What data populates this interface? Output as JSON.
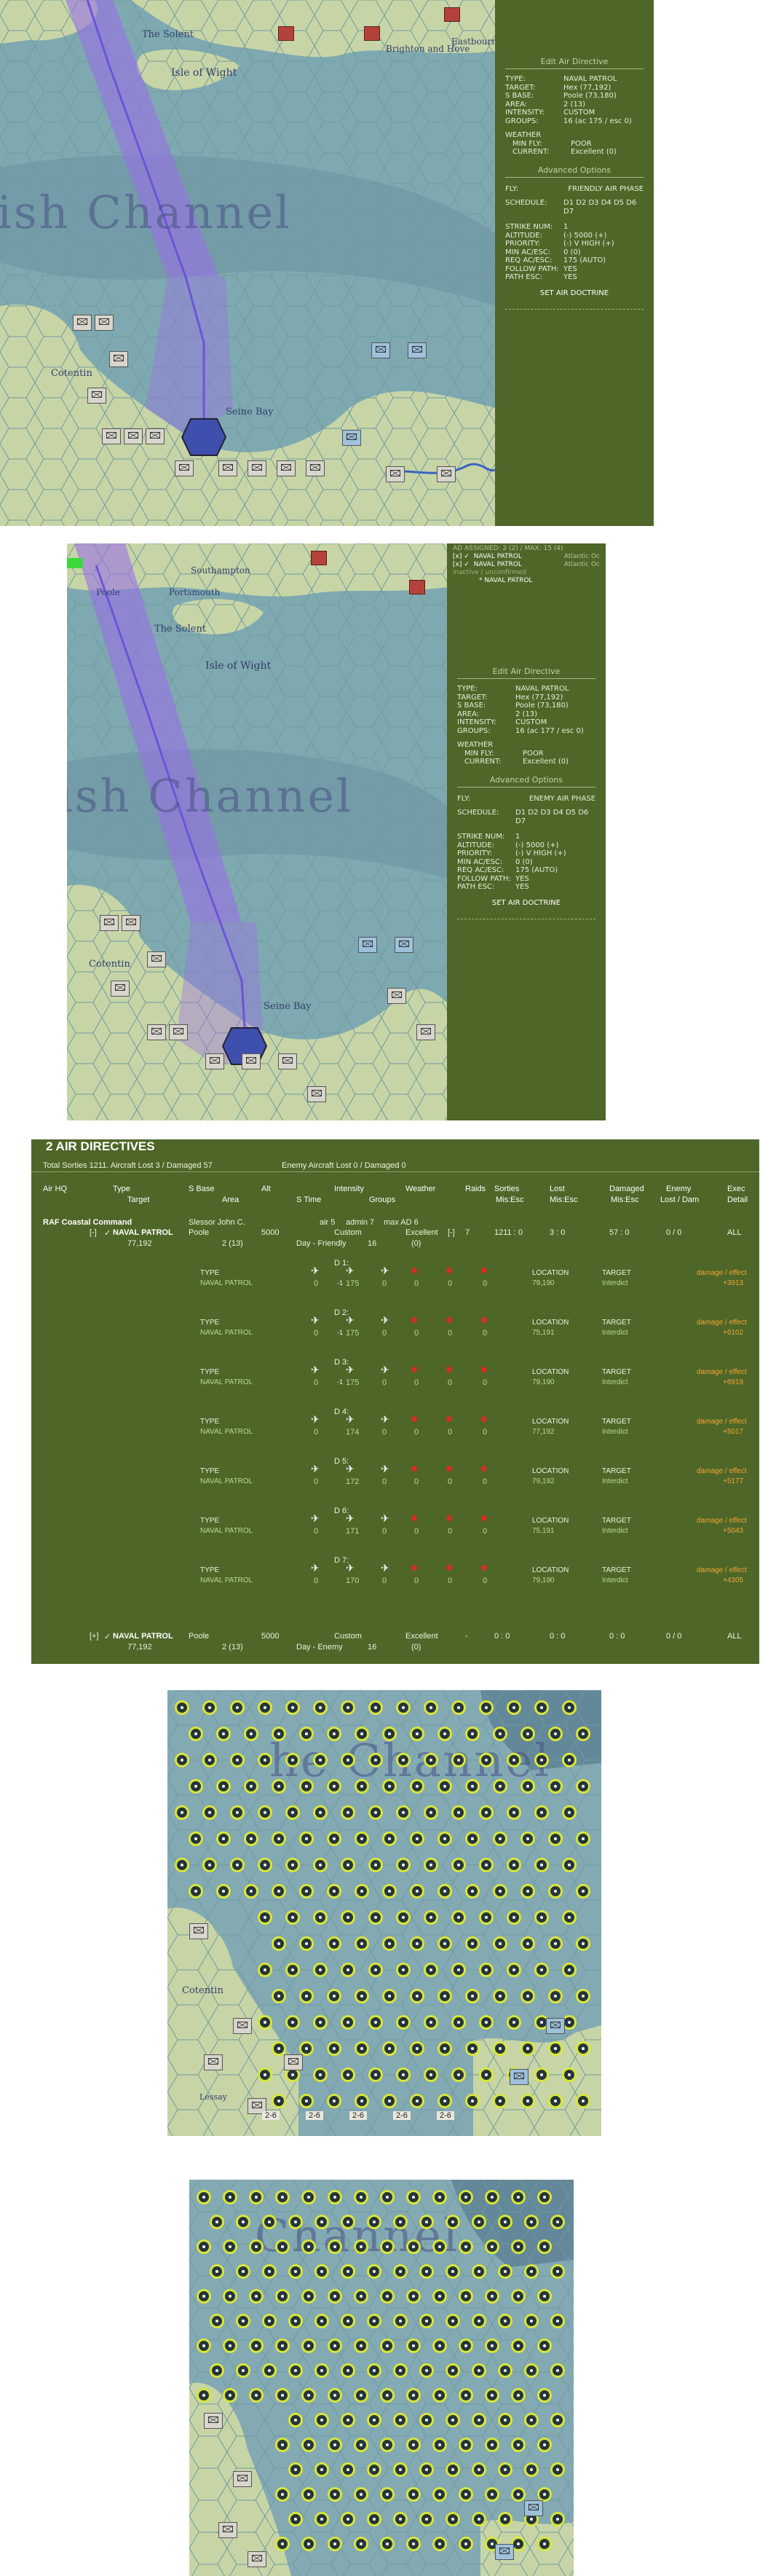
{
  "screen1": {
    "places": {
      "isle_of_wight": "Isle of Wight",
      "seine_bay": "Seine Bay",
      "eastbourne": "Eastbourne",
      "brighton": "Brighton and Hove",
      "cotentin": "Cotentin",
      "the_solent": "The Solent",
      "sea": "ish Channel"
    },
    "panel": {
      "title": "Edit Air Directive",
      "fields": [
        {
          "k": "TYPE:",
          "v": "NAVAL PATROL"
        },
        {
          "k": "TARGET:",
          "v": "Hex (77,192)"
        },
        {
          "k": "S BASE:",
          "v": "Poole (73,180)"
        },
        {
          "k": "AREA:",
          "v": "2 (13)"
        },
        {
          "k": "INTENSITY:",
          "v": "CUSTOM"
        },
        {
          "k": "GROUPS:",
          "v": "16 (ac 175 / esc 0)"
        }
      ],
      "weather_label": "WEATHER",
      "weather": [
        {
          "k": "MIN FLY:",
          "v": "POOR"
        },
        {
          "k": "CURRENT:",
          "v": "Excellent (0)"
        }
      ],
      "advanced": "Advanced Options",
      "fly_k": "FLY:",
      "fly_v": "FRIENDLY AIR PHASE",
      "schedule_k": "SCHEDULE:",
      "schedule_v": "D1 D2 D3 D4 D5 D6 D7",
      "opts": [
        {
          "k": "STRIKE NUM:",
          "v": "1"
        },
        {
          "k": "ALTITUDE:",
          "v": "(-) 5000 (+)"
        },
        {
          "k": "PRIORITY:",
          "v": "(-) V HIGH (+)"
        },
        {
          "k": "MIN AC/ESC:",
          "v": "0 (0)"
        },
        {
          "k": "REQ AC/ESC:",
          "v": "175 (AUTO)"
        },
        {
          "k": "FOLLOW PATH:",
          "v": "YES"
        },
        {
          "k": "PATH ESC:",
          "v": "YES"
        }
      ],
      "set_btn": "SET AIR DOCTRINE"
    }
  },
  "screen2": {
    "places": {
      "southampton": "Southampton",
      "portsmouth": "Portsmouth",
      "poole": "Poole",
      "the_solent": "The Solent",
      "isle_of_wight": "Isle of Wight",
      "seine_bay": "Seine Bay",
      "cotentin": "Cotentin",
      "sea": "ish Channel"
    },
    "assigned": {
      "head": "AD ASSIGNED: 2 (2) / MAX: 15 (4)",
      "items": [
        {
          "label": "NAVAL PATROL",
          "target": "Atlantic Oc"
        },
        {
          "label": "NAVAL PATROL",
          "target": "Atlantic Oc"
        }
      ],
      "inactive": "inactive / unconfirmed",
      "sub": "* NAVAL PATROL"
    },
    "panel": {
      "title": "Edit Air Directive",
      "fields": [
        {
          "k": "TYPE:",
          "v": "NAVAL PATROL"
        },
        {
          "k": "TARGET:",
          "v": "Hex (77,192)"
        },
        {
          "k": "S BASE:",
          "v": "Poole (73,180)"
        },
        {
          "k": "AREA:",
          "v": "2 (13)"
        },
        {
          "k": "INTENSITY:",
          "v": "CUSTOM"
        },
        {
          "k": "GROUPS:",
          "v": "16 (ac 177 / esc 0)"
        }
      ],
      "weather_label": "WEATHER",
      "weather": [
        {
          "k": "MIN FLY:",
          "v": "POOR"
        },
        {
          "k": "CURRENT:",
          "v": "Excellent (0)"
        }
      ],
      "advanced": "Advanced Options",
      "fly_k": "FLY:",
      "fly_v": "ENEMY AIR PHASE",
      "schedule_k": "SCHEDULE:",
      "schedule_v": "D1 D2 D3 D4 D5 D6 D7",
      "opts": [
        {
          "k": "STRIKE NUM:",
          "v": "1"
        },
        {
          "k": "ALTITUDE:",
          "v": "(-) 5000 (+)"
        },
        {
          "k": "PRIORITY:",
          "v": "(-) V HIGH (+)"
        },
        {
          "k": "MIN AC/ESC:",
          "v": "0 (0)"
        },
        {
          "k": "REQ AC/ESC:",
          "v": "175 (AUTO)"
        },
        {
          "k": "FOLLOW PATH:",
          "v": "YES"
        },
        {
          "k": "PATH ESC:",
          "v": "YES"
        }
      ],
      "set_btn": "SET AIR DOCTRINE"
    }
  },
  "directives": {
    "title": "2 AIR DIRECTIVES",
    "totals": "Total Sorties 1211. Aircraft Lost 3 / Damaged 57",
    "enemy_totals": "Enemy Aircraft Lost 0 / Damaged 0",
    "headers": {
      "airhq": "Air HQ",
      "type": "Type",
      "target": "Target",
      "sbase": "S Base",
      "area": "Area",
      "alt": "Alt",
      "stime": "S Time",
      "intensity": "Intensity",
      "groups": "Groups",
      "weather": "Weather",
      "raids": "Raids",
      "sorties": "Sorties",
      "miss_esc": "Mis:Esc",
      "lost": "Lost",
      "lost_sub": "Mis:Esc",
      "damaged": "Damaged",
      "dam_sub": "Mis:Esc",
      "enemy": "Enemy",
      "enemy_sub": "Lost / Dam",
      "exec": "Exec",
      "exec_sub": "Detail"
    },
    "hq": {
      "name": "RAF Coastal Command",
      "commander": "Slessor John C.",
      "air": "air 5",
      "admin": "admin 7",
      "max": "max AD 6"
    },
    "d1": {
      "toggle": "[-]",
      "type": "NAVAL PATROL",
      "target": "77,192",
      "sbase": "Poole",
      "area": "2 (13)",
      "alt": "5000",
      "stime": "Day - Friendly",
      "intensity": "Custom",
      "groups": "16",
      "weather": "Excellent",
      "weather_sub": "(0)",
      "raids_cb": "[-]",
      "raids": "7",
      "sorties": "1211 : 0",
      "lost": "3 : 0",
      "damaged": "57 : 0",
      "enemy": "0 / 0",
      "exec": "ALL"
    },
    "days": [
      {
        "day": "D 1:",
        "sub": "-1",
        "type": "NAVAL PATROL",
        "a": "0",
        "b": "175",
        "c": "0",
        "d": "0",
        "e": "0",
        "f": "0",
        "loc": "79,190",
        "target": "Interdict",
        "link": "damage / effect",
        "effect": "+3913"
      },
      {
        "day": "D 2:",
        "sub": "-1",
        "type": "NAVAL PATROL",
        "a": "0",
        "b": "175",
        "c": "0",
        "d": "0",
        "e": "0",
        "f": "0",
        "loc": "75,191",
        "target": "Interdict",
        "link": "damage / effect",
        "effect": "+6102"
      },
      {
        "day": "D 3:",
        "sub": "-1",
        "type": "NAVAL PATROL",
        "a": "0",
        "b": "175",
        "c": "0",
        "d": "0",
        "e": "0",
        "f": "0",
        "loc": "79,190",
        "target": "Interdict",
        "link": "damage / effect",
        "effect": "+6919"
      },
      {
        "day": "D 4:",
        "sub": "",
        "type": "NAVAL PATROL",
        "a": "0",
        "b": "174",
        "c": "0",
        "d": "0",
        "e": "0",
        "f": "0",
        "loc": "77,192",
        "target": "Interdict",
        "link": "damage / effect",
        "effect": "+5017"
      },
      {
        "day": "D 5:",
        "sub": "",
        "type": "NAVAL PATROL",
        "a": "0",
        "b": "172",
        "c": "0",
        "d": "0",
        "e": "0",
        "f": "0",
        "loc": "79,192",
        "target": "Interdict",
        "link": "damage / effect",
        "effect": "+5177"
      },
      {
        "day": "D 6:",
        "sub": "",
        "type": "NAVAL PATROL",
        "a": "0",
        "b": "171",
        "c": "0",
        "d": "0",
        "e": "0",
        "f": "0",
        "loc": "75,191",
        "target": "Interdict",
        "link": "damage / effect",
        "effect": "+5043"
      },
      {
        "day": "D 7:",
        "sub": "",
        "type": "NAVAL PATROL",
        "a": "0",
        "b": "170",
        "c": "0",
        "d": "0",
        "e": "0",
        "f": "0",
        "loc": "79,190",
        "target": "Interdict",
        "link": "damage / effect",
        "effect": "+4305"
      }
    ],
    "labels": {
      "type": "TYPE",
      "location": "LOCATION",
      "target": "TARGET"
    },
    "d2": {
      "toggle": "[+]",
      "type": "NAVAL PATROL",
      "target": "77,192",
      "sbase": "Poole",
      "area": "2 (13)",
      "alt": "5000",
      "stime": "Day - Enemy",
      "intensity": "Custom",
      "groups": "16",
      "weather": "Excellent",
      "weather_sub": "(0)",
      "raids": "-",
      "sorties": "0 : 0",
      "lost": "0 : 0",
      "damaged": "0 : 0",
      "enemy": "0 / 0",
      "exec": "ALL"
    }
  },
  "screen3": {
    "places": {
      "cotentin": "Cotentin",
      "lessay": "Lessay",
      "sea": "he Channel"
    },
    "counters": [
      "2-6",
      "2-6",
      "2-6",
      "2-6",
      "2-6"
    ]
  },
  "screen4": {
    "places": {
      "sea": "Channel"
    }
  }
}
